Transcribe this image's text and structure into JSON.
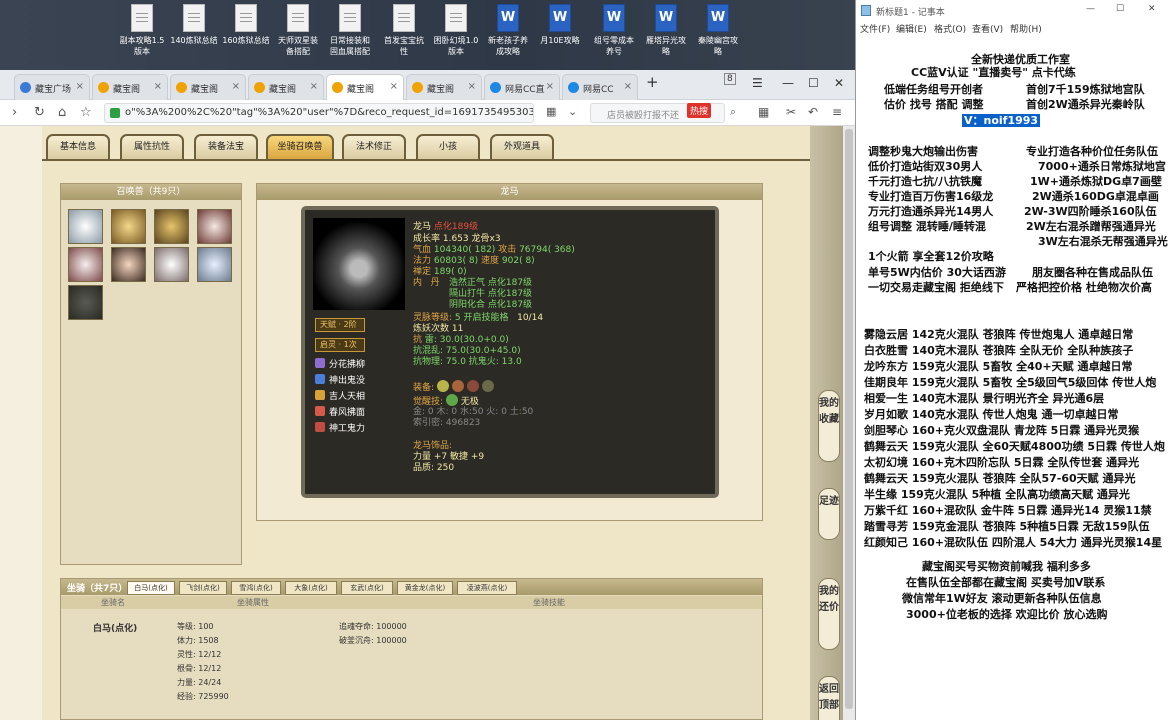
{
  "desktop": {
    "icons": [
      {
        "label": "副本攻略1.5\n版本",
        "type": "doc"
      },
      {
        "label": "140炼狱总结",
        "type": "doc"
      },
      {
        "label": "160炼狱总结",
        "type": "doc"
      },
      {
        "label": "天师双星装\n备搭配",
        "type": "doc"
      },
      {
        "label": "日常接装和\n固血属搭配",
        "type": "doc"
      },
      {
        "label": "首发宝宝抗\n性",
        "type": "doc"
      },
      {
        "label": "困卧幻境1.0\n版本",
        "type": "doc"
      },
      {
        "label": "新老孩子养\n成攻略",
        "type": "word"
      },
      {
        "label": "月10E攻略",
        "type": "word"
      },
      {
        "label": "组号零成本\n养号",
        "type": "word"
      },
      {
        "label": "雁塔异光攻\n略",
        "type": "word"
      },
      {
        "label": "秦陵幽宫攻\n略",
        "type": "word"
      }
    ]
  },
  "browser": {
    "tabs": [
      {
        "label": "藏宝广场"
      },
      {
        "label": "藏宝阁"
      },
      {
        "label": "藏宝阁"
      },
      {
        "label": "藏宝阁"
      },
      {
        "label": "藏宝阁"
      },
      {
        "label": "藏宝阁"
      },
      {
        "label": "网易CC直"
      },
      {
        "label": "网易CC"
      }
    ],
    "tab_count": "8",
    "url": "o\"%3A%200%2C%20\"tag\"%3A%20\"user\"%7D&reco_request_id=1691735495303hxHkz",
    "search_placeholder": "店员被殴打报不还",
    "hot_label": "热搜"
  },
  "game": {
    "tabs": [
      "基本信息",
      "属性抗性",
      "装备法宝",
      "坐骑召唤兽",
      "法术修正",
      "小孩",
      "外观道具"
    ],
    "active_tab": "坐骑召唤兽",
    "pet_list_title": "召唤兽（共9只）",
    "detail_title": "龙马",
    "pet": {
      "name": "龙马",
      "level": "点化189级",
      "line1": "成长率 1.653 龙骨x3",
      "hp_label": "气血",
      "hp": "104340( 182)",
      "atk_label": "攻击",
      "atk": "76794( 368)",
      "mp_label": "法力",
      "mp": "60803( 8)",
      "speed_label": "速度",
      "speed": "902( 8)",
      "ding_label": "禅定",
      "ding": "189( 0)",
      "nei_label": "内",
      "dan_label": "丹",
      "dan1": "浩然正气 点化187级",
      "dan2": "隔山打牛 点化187级",
      "dan3": "阴阳化合 点化187级",
      "soul_label": "灵脉等级:",
      "soul_value": "5  开启技能格",
      "soul_progress": "10/14",
      "refine": "炼妖次数 11",
      "kang_label": "抗",
      "kang_lei": "雷: 30.0(30.0+0.0)",
      "kang_hun": "抗混乱: 75.0(30.0+45.0)",
      "kang_wu": "抗物理: 75.0  抗鬼火: 13.0",
      "equip_label": "装备:",
      "awaken_label": "觉醒技:",
      "awaken_value": "无极",
      "elements": "金: 0 木: 0 水:50  火: 0 土:50",
      "hidden_label": "索引密:",
      "hidden_value": "496823",
      "ornament_label": "龙马饰品:",
      "ornament_line1": "力量 +7 敏捷 +9",
      "ornament_line2": "品质: 250",
      "talent": "天赋 · 2阶",
      "qiling": "启灵 · 1次",
      "skills": [
        "分花拂柳",
        "神出鬼没",
        "吉人天相",
        "春风拂面",
        "神工鬼力"
      ]
    },
    "mount": {
      "title": "坐骑（共7只）",
      "tabs": [
        "白马(点化)",
        "飞剑(点化)",
        "雪鸿(点化)",
        "大象(点化)",
        "玄武(点化)",
        "黄金龙(点化)",
        "凌波燕(点化)"
      ],
      "headers": [
        "坐骑名",
        "坐骑属性",
        "坐骑技能"
      ],
      "name": "白马(点化)",
      "stats": [
        "等级: 100",
        "体力: 1508",
        "灵性: 12/12",
        "根骨: 12/12",
        "力量: 24/24",
        "经验: 725990"
      ],
      "skills": [
        "追魂夺命: 100000",
        "破釜沉舟: 100000"
      ]
    }
  },
  "side_buttons": [
    "我的收藏",
    "足迹",
    "我的还价",
    "返回顶部"
  ],
  "notepad": {
    "title": "新标题1 - 记事本",
    "menu": [
      "文件(F)",
      "编辑(E)",
      "格式(O)",
      "查看(V)",
      "帮助(H)"
    ],
    "lines": [
      "全新快递优质工作室",
      "CC蓝V认证 \"直播卖号\" 点卡代练",
      "低端任务组号开创者",
      "首创7千159炼狱地宫队",
      "估价 找号 搭配 调整",
      "首创2W通杀异光秦岭队",
      "V：noif1993",
      "调整秒鬼大炮输出伤害",
      "专业打造各种价位任务队伍",
      "低价打造站街双30男人",
      "7000+通杀日常炼狱地宫",
      "千元打造七抗/八抗铁魔",
      "1W+通杀炼狱DG卓7画壁",
      "专业打造百万伤害16级龙",
      "2W通杀160DG卓混卓画",
      "万元打造通杀异光14男人",
      "2W-3W四阶睡杀160队伍",
      "组号调整 混转睡/睡转混",
      "2W左右混杀蹭帮强通异光",
      "3W左右混杀无帮强通异光",
      "1个火箭 享全套12价攻略",
      "单号5W内估价 30大话西游",
      "朋友圈各种在售成品队伍",
      "一切交易走藏宝阁 拒绝线下",
      "严格把控价格 杜绝物次价高",
      "雾隐云居 142克火混队 苍狼阵 传世炮鬼人 通卓越日常",
      "白衣胜雪 140克木混队 苍狼阵 全队无价 全队种族孩子",
      "龙吟东方 159克火混队 5畜牧 全40+天赋 通卓越日常",
      "佳期良年 159克火混队 5畜牧 全5级回气5级回体 传世人炮",
      "相爱一生 140克木混队 景行明光齐全 异光通6层",
      "岁月如歌 140克水混队 传世人炮鬼 通一切卓越日常",
      "剑胆琴心 160+克火双盘混队 青龙阵 5日霖 通异光灵猴",
      "鹤舞云天 159克火混队 全60天赋4800功绩 5日霖 传世人炮",
      "太初幻境 160+克木四阶忘队 5日霖 全队传世套 通异光",
      "鹤舞云天 159克火混队 苍狼阵 全队57-60天赋 通异光",
      "半生缘    159克火混队 5种植 全队高功绩高天赋 通异光",
      "万紫千红 160+混砍队 金牛阵 5日霖 通异光14 灵猴11禁",
      "踏雪寻芳 159克金混队 苍狼阵 5种植5日霖 无敌159队伍",
      "红颜知己 160+混砍队伍 四阶混人 54大力 通异光灵猴14星",
      "藏宝阁买号买物资前喊我 福利多多",
      "在售队伍全部都在藏宝阁 买卖号加V联系",
      "微信常年1W好友 滚动更新各种队伍信息",
      "3000+位老板的选择 欢迎比价 放心选购"
    ]
  }
}
